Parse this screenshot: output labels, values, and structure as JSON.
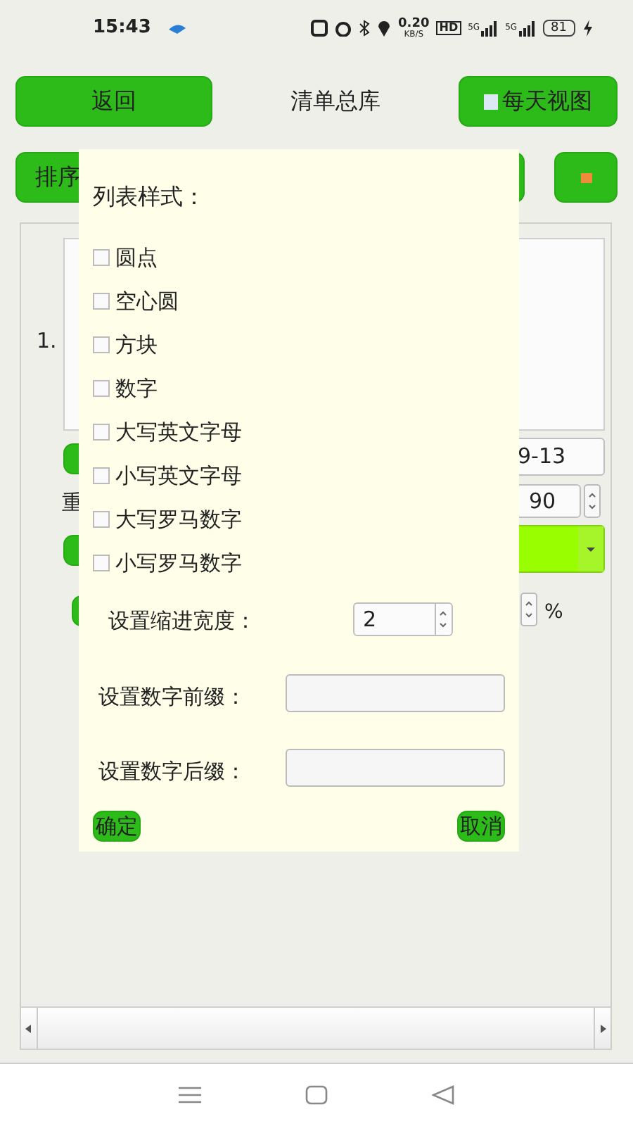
{
  "status_bar": {
    "time": "15:43",
    "net_speed": "0.20",
    "net_unit": "KB/S",
    "hd": "HD",
    "signal_labels": [
      "5G",
      "5G"
    ],
    "battery": "81"
  },
  "header": {
    "back": "返回",
    "title": "清单总库",
    "daily_view": "每天视图"
  },
  "toolbar": {
    "sort": "排序"
  },
  "editor": {
    "list_number": "1.",
    "date_value": "9-13",
    "repeat_label": "重",
    "repeat_value": "90",
    "percent_unit": "%"
  },
  "dialog": {
    "title": "列表样式：",
    "styles": [
      {
        "label": "圆点",
        "checked": false
      },
      {
        "label": "空心圆",
        "checked": false
      },
      {
        "label": "方块",
        "checked": false
      },
      {
        "label": "数字",
        "checked": false
      },
      {
        "label": "大写英文字母",
        "checked": false
      },
      {
        "label": "小写英文字母",
        "checked": false
      },
      {
        "label": "大写罗马数字",
        "checked": false
      },
      {
        "label": "小写罗马数字",
        "checked": false
      }
    ],
    "indent": {
      "label": "设置缩进宽度：",
      "value": "2"
    },
    "prefix": {
      "label": "设置数字前缀："
    },
    "suffix": {
      "label": "设置数字后缀："
    },
    "ok": "确定",
    "cancel": "取消"
  }
}
